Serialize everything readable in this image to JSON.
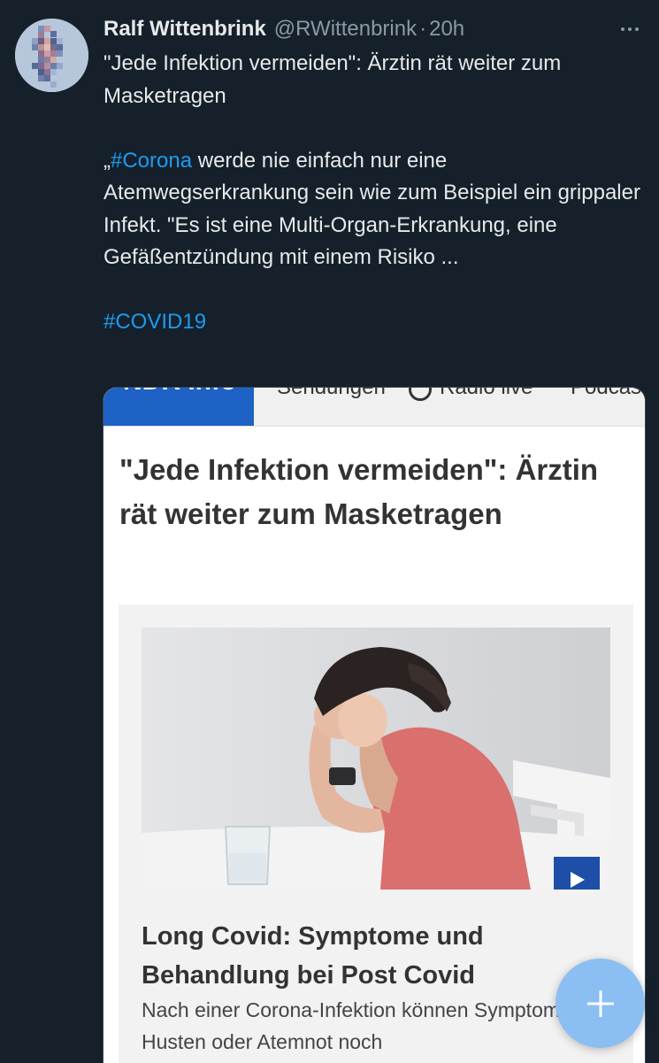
{
  "tweet": {
    "author_name": "Ralf Wittenbrink",
    "handle": "@RWittenbrink",
    "separator": "·",
    "time": "20h",
    "line1": "\"Jede Infektion vermeiden\": Ärztin rät weiter zum Masketragen",
    "quote_open": "„",
    "hashtag_corona": "#Corona",
    "body_rest": " werde nie einfach nur eine Atemwegserkrankung sein wie zum Beispiel ein grippaler Infekt. \"Es ist eine Multi-Organ-Erkrankung, eine Gefäßentzündung mit einem Risiko ...",
    "hashtag_covid": "#COVID19"
  },
  "card": {
    "nav": {
      "logo": "NDR Info",
      "items": [
        "Sendungen",
        "Radio live",
        "Podcasts"
      ]
    },
    "article_title": "\"Jede Infektion vermeiden\": Ärztin rät weiter zum Masketragen",
    "teaser": {
      "title": "Long Covid: Symptome und Behandlung bei Post Covid",
      "text": "Nach einer Corona-Infektion können Symptome wie Husten oder Atemnot noch"
    }
  },
  "icons": {
    "more": "more-horizontal-icon",
    "play": "play-icon",
    "compose": "plus-icon",
    "radio": "radio-icon"
  },
  "colors": {
    "background": "#15202b",
    "text": "#e7e9ea",
    "secondary": "#8b98a5",
    "link": "#1d9bf0",
    "ndr_blue": "#1d62c4",
    "fab": "#8bbef2"
  }
}
